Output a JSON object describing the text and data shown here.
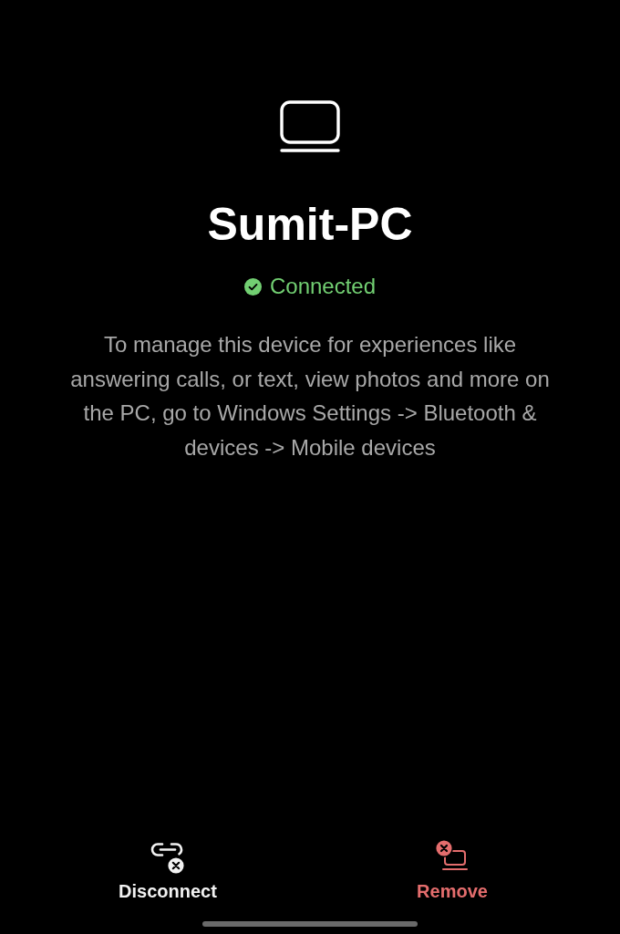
{
  "device": {
    "name": "Sumit-PC",
    "status": {
      "label": "Connected",
      "connected": true
    }
  },
  "description": "To manage this device for experiences like answering calls, or text, view photos and more on the PC, go to Windows Settings -> Bluetooth & devices -> Mobile devices",
  "actions": [
    {
      "kind": "disconnect",
      "label": "Disconnect"
    },
    {
      "kind": "remove",
      "label": "Remove"
    }
  ]
}
